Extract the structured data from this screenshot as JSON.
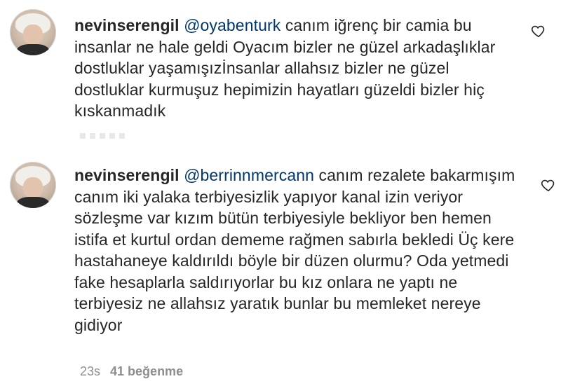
{
  "comments": [
    {
      "username": "nevinserengil",
      "mention": "@oyabenturk",
      "text": " canım iğrenç bir camia bu insanlar ne hale geldi Oyacım bizler ne güzel arkadaşlıklar dostluklar yaşamışızİnsanlar allahsız bizler ne güzel dostluklar kurmuşuz hepimizin hayatları güzeldi bizler hiç kıskanmadık",
      "icon": "heart-outline-icon"
    },
    {
      "username": "nevinserengil",
      "mention": "@berrinnmercann",
      "text": " canım rezalete bakarmışım canım iki yalaka terbiyesizlik yapıyor kanal izin veriyor sözleşme var kızım bütün terbiyesiyle bekliyor ben hemen istifa et kurtul ordan dememe rağmen sabırla bekledi Üç kere hastahaneye kaldırıldı böyle bir düzen olurmu? Oda yetmedi fake hesaplarla saldırıyorlar bu kız onlara ne yaptı ne terbiyesiz ne allahsız yaratık bunlar bu memleket nereye gidiyor",
      "time": "23s",
      "likes": "41 beğenme",
      "icon": "heart-outline-icon"
    }
  ]
}
